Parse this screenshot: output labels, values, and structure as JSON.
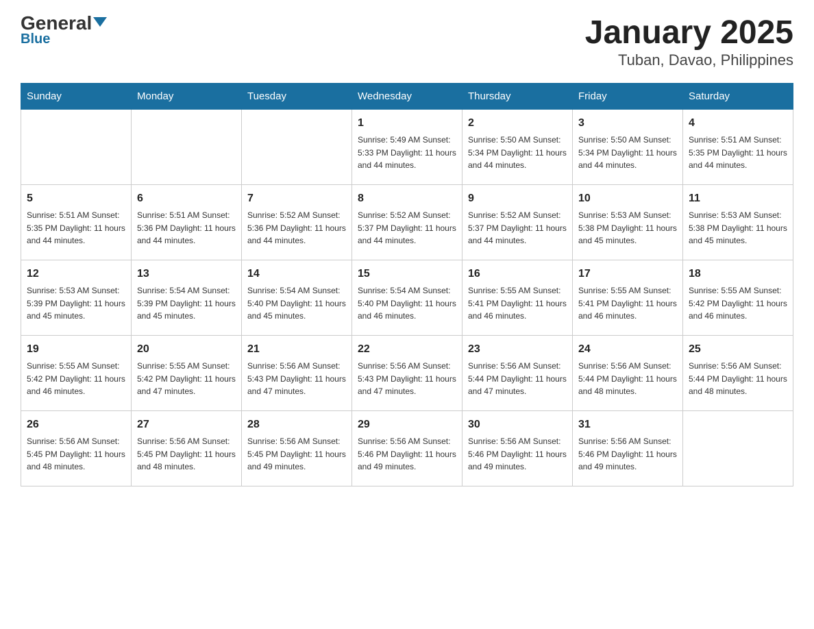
{
  "logo": {
    "general": "General",
    "blue": "Blue"
  },
  "title": "January 2025",
  "subtitle": "Tuban, Davao, Philippines",
  "days_header": [
    "Sunday",
    "Monday",
    "Tuesday",
    "Wednesday",
    "Thursday",
    "Friday",
    "Saturday"
  ],
  "weeks": [
    [
      {
        "day": "",
        "info": ""
      },
      {
        "day": "",
        "info": ""
      },
      {
        "day": "",
        "info": ""
      },
      {
        "day": "1",
        "info": "Sunrise: 5:49 AM\nSunset: 5:33 PM\nDaylight: 11 hours and 44 minutes."
      },
      {
        "day": "2",
        "info": "Sunrise: 5:50 AM\nSunset: 5:34 PM\nDaylight: 11 hours and 44 minutes."
      },
      {
        "day": "3",
        "info": "Sunrise: 5:50 AM\nSunset: 5:34 PM\nDaylight: 11 hours and 44 minutes."
      },
      {
        "day": "4",
        "info": "Sunrise: 5:51 AM\nSunset: 5:35 PM\nDaylight: 11 hours and 44 minutes."
      }
    ],
    [
      {
        "day": "5",
        "info": "Sunrise: 5:51 AM\nSunset: 5:35 PM\nDaylight: 11 hours and 44 minutes."
      },
      {
        "day": "6",
        "info": "Sunrise: 5:51 AM\nSunset: 5:36 PM\nDaylight: 11 hours and 44 minutes."
      },
      {
        "day": "7",
        "info": "Sunrise: 5:52 AM\nSunset: 5:36 PM\nDaylight: 11 hours and 44 minutes."
      },
      {
        "day": "8",
        "info": "Sunrise: 5:52 AM\nSunset: 5:37 PM\nDaylight: 11 hours and 44 minutes."
      },
      {
        "day": "9",
        "info": "Sunrise: 5:52 AM\nSunset: 5:37 PM\nDaylight: 11 hours and 44 minutes."
      },
      {
        "day": "10",
        "info": "Sunrise: 5:53 AM\nSunset: 5:38 PM\nDaylight: 11 hours and 45 minutes."
      },
      {
        "day": "11",
        "info": "Sunrise: 5:53 AM\nSunset: 5:38 PM\nDaylight: 11 hours and 45 minutes."
      }
    ],
    [
      {
        "day": "12",
        "info": "Sunrise: 5:53 AM\nSunset: 5:39 PM\nDaylight: 11 hours and 45 minutes."
      },
      {
        "day": "13",
        "info": "Sunrise: 5:54 AM\nSunset: 5:39 PM\nDaylight: 11 hours and 45 minutes."
      },
      {
        "day": "14",
        "info": "Sunrise: 5:54 AM\nSunset: 5:40 PM\nDaylight: 11 hours and 45 minutes."
      },
      {
        "day": "15",
        "info": "Sunrise: 5:54 AM\nSunset: 5:40 PM\nDaylight: 11 hours and 46 minutes."
      },
      {
        "day": "16",
        "info": "Sunrise: 5:55 AM\nSunset: 5:41 PM\nDaylight: 11 hours and 46 minutes."
      },
      {
        "day": "17",
        "info": "Sunrise: 5:55 AM\nSunset: 5:41 PM\nDaylight: 11 hours and 46 minutes."
      },
      {
        "day": "18",
        "info": "Sunrise: 5:55 AM\nSunset: 5:42 PM\nDaylight: 11 hours and 46 minutes."
      }
    ],
    [
      {
        "day": "19",
        "info": "Sunrise: 5:55 AM\nSunset: 5:42 PM\nDaylight: 11 hours and 46 minutes."
      },
      {
        "day": "20",
        "info": "Sunrise: 5:55 AM\nSunset: 5:42 PM\nDaylight: 11 hours and 47 minutes."
      },
      {
        "day": "21",
        "info": "Sunrise: 5:56 AM\nSunset: 5:43 PM\nDaylight: 11 hours and 47 minutes."
      },
      {
        "day": "22",
        "info": "Sunrise: 5:56 AM\nSunset: 5:43 PM\nDaylight: 11 hours and 47 minutes."
      },
      {
        "day": "23",
        "info": "Sunrise: 5:56 AM\nSunset: 5:44 PM\nDaylight: 11 hours and 47 minutes."
      },
      {
        "day": "24",
        "info": "Sunrise: 5:56 AM\nSunset: 5:44 PM\nDaylight: 11 hours and 48 minutes."
      },
      {
        "day": "25",
        "info": "Sunrise: 5:56 AM\nSunset: 5:44 PM\nDaylight: 11 hours and 48 minutes."
      }
    ],
    [
      {
        "day": "26",
        "info": "Sunrise: 5:56 AM\nSunset: 5:45 PM\nDaylight: 11 hours and 48 minutes."
      },
      {
        "day": "27",
        "info": "Sunrise: 5:56 AM\nSunset: 5:45 PM\nDaylight: 11 hours and 48 minutes."
      },
      {
        "day": "28",
        "info": "Sunrise: 5:56 AM\nSunset: 5:45 PM\nDaylight: 11 hours and 49 minutes."
      },
      {
        "day": "29",
        "info": "Sunrise: 5:56 AM\nSunset: 5:46 PM\nDaylight: 11 hours and 49 minutes."
      },
      {
        "day": "30",
        "info": "Sunrise: 5:56 AM\nSunset: 5:46 PM\nDaylight: 11 hours and 49 minutes."
      },
      {
        "day": "31",
        "info": "Sunrise: 5:56 AM\nSunset: 5:46 PM\nDaylight: 11 hours and 49 minutes."
      },
      {
        "day": "",
        "info": ""
      }
    ]
  ]
}
